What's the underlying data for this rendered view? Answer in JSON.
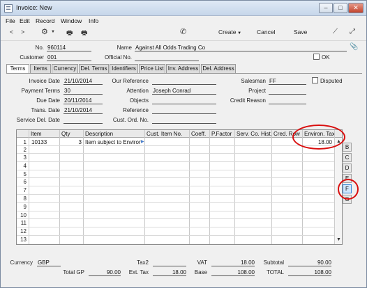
{
  "window": {
    "title": "Invoice: New"
  },
  "menu": [
    "File",
    "Edit",
    "Record",
    "Window",
    "Info"
  ],
  "toolbar": {
    "create_label": "Create",
    "cancel_label": "Cancel",
    "save_label": "Save"
  },
  "header": {
    "no_label": "No.",
    "no_value": "960114",
    "name_label": "Name",
    "name_value": "Against All Odds Trading Co",
    "customer_label": "Customer",
    "customer_value": "001",
    "official_no_label": "Official No.",
    "official_no_value": "",
    "ok_label": "OK"
  },
  "tabs": [
    "Terms",
    "Items",
    "Currency",
    "Del. Terms",
    "Identifiers",
    "Price List",
    "Inv. Address",
    "Del. Address"
  ],
  "terms": {
    "invoice_date_label": "Invoice Date",
    "invoice_date_value": "21/10/2014",
    "payment_terms_label": "Payment Terms",
    "payment_terms_value": "30",
    "due_date_label": "Due Date",
    "due_date_value": "20/11/2014",
    "trans_date_label": "Trans. Date",
    "trans_date_value": "21/10/2014",
    "service_del_date_label": "Service Del. Date",
    "service_del_date_value": "",
    "our_reference_label": "Our Reference",
    "attention_label": "Attention",
    "attention_value": "Joseph Conrad",
    "objects_label": "Objects",
    "reference_label": "Reference",
    "cust_ord_no_label": "Cust. Ord. No.",
    "salesman_label": "Salesman",
    "salesman_value": "FF",
    "disputed_label": "Disputed",
    "project_label": "Project",
    "credit_reason_label": "Credit Reason"
  },
  "grid": {
    "columns": [
      "Item",
      "Qty",
      "Description",
      "Cust. Item No.",
      "Coeff.",
      "P.Factor",
      "Serv. Co. Hist.",
      "Cred. Row",
      "Environ. Tax"
    ],
    "row_numbers": [
      "1",
      "2",
      "3",
      "4",
      "5",
      "6",
      "7",
      "8",
      "9",
      "10",
      "11",
      "12",
      "13"
    ],
    "rows": [
      {
        "item": "10133",
        "qty": "3",
        "description": "Item subject to Environ",
        "environ_tax": "18.00"
      }
    ]
  },
  "side_buttons": [
    "B",
    "C",
    "D",
    "E",
    "F",
    "G"
  ],
  "footer": {
    "currency_label": "Currency",
    "currency_value": "GBP",
    "total_gp_label": "Total GP",
    "total_gp_value": "90.00",
    "tax2_label": "Tax2",
    "tax2_value": "",
    "ext_tax_label": "Ext. Tax",
    "ext_tax_value": "18.00",
    "vat_label": "VAT",
    "vat_value": "18.00",
    "base_label": "Base",
    "base_value": "108.00",
    "subtotal_label": "Subtotal",
    "subtotal_value": "90.00",
    "total_label": "TOTAL",
    "total_value": "108.00"
  }
}
